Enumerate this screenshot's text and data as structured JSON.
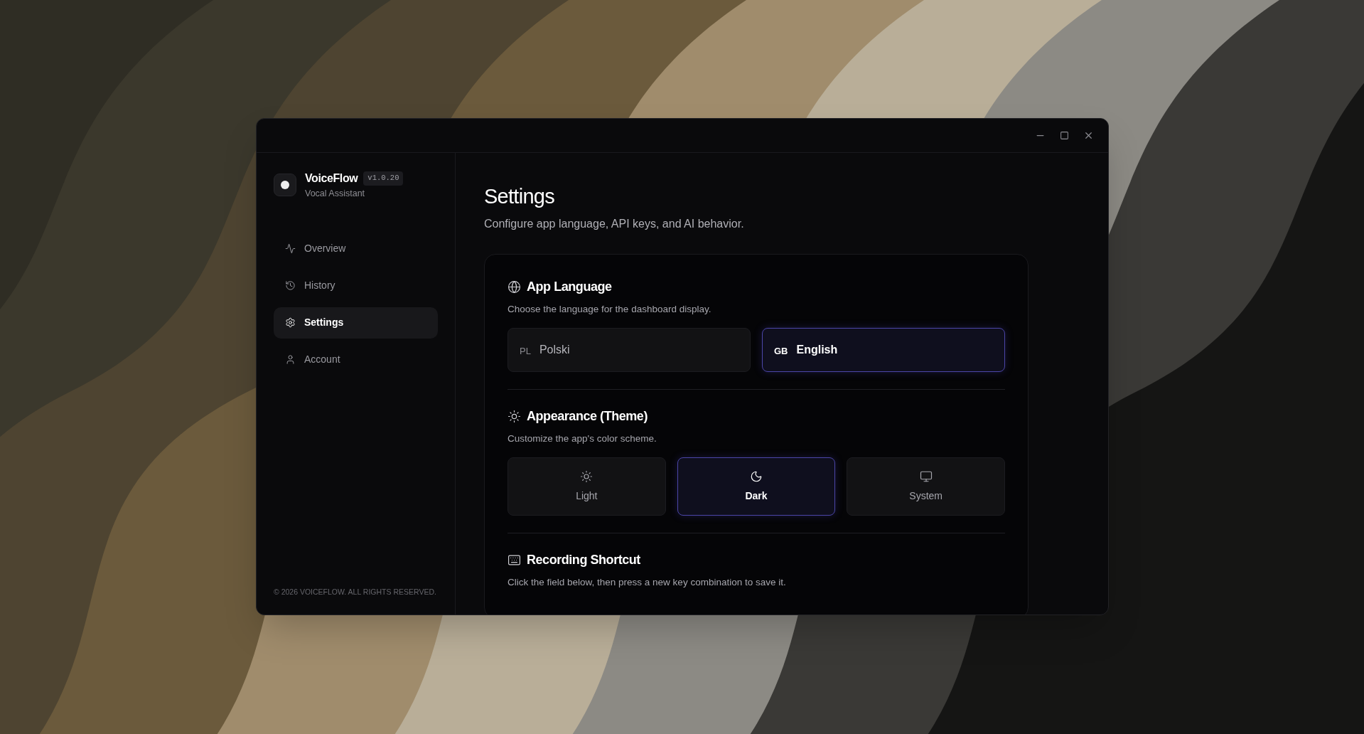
{
  "app": {
    "name": "VoiceFlow",
    "version": "v1.0.20",
    "subtitle": "Vocal Assistant"
  },
  "nav": [
    {
      "label": "Overview",
      "selected": false
    },
    {
      "label": "History",
      "selected": false
    },
    {
      "label": "Settings",
      "selected": true
    },
    {
      "label": "Account",
      "selected": false
    }
  ],
  "footer": "© 2026 VOICEFLOW. ALL RIGHTS RESERVED.",
  "page": {
    "title": "Settings",
    "subtitle": "Configure app language, API keys, and AI behavior."
  },
  "sections": [
    {
      "kind": "language",
      "title": "App Language",
      "description": "Choose the language for the dashboard display.",
      "options": [
        {
          "code": "PL",
          "label": "Polski",
          "selected": false
        },
        {
          "code": "GB",
          "label": "English",
          "selected": true
        }
      ]
    },
    {
      "kind": "theme",
      "title": "Appearance (Theme)",
      "description": "Customize the app's color scheme.",
      "options": [
        {
          "label": "Light",
          "selected": false
        },
        {
          "label": "Dark",
          "selected": true
        },
        {
          "label": "System",
          "selected": false
        }
      ]
    },
    {
      "kind": "shortcut",
      "title": "Recording Shortcut",
      "description": "Click the field below, then press a new key combination to save it."
    }
  ]
}
